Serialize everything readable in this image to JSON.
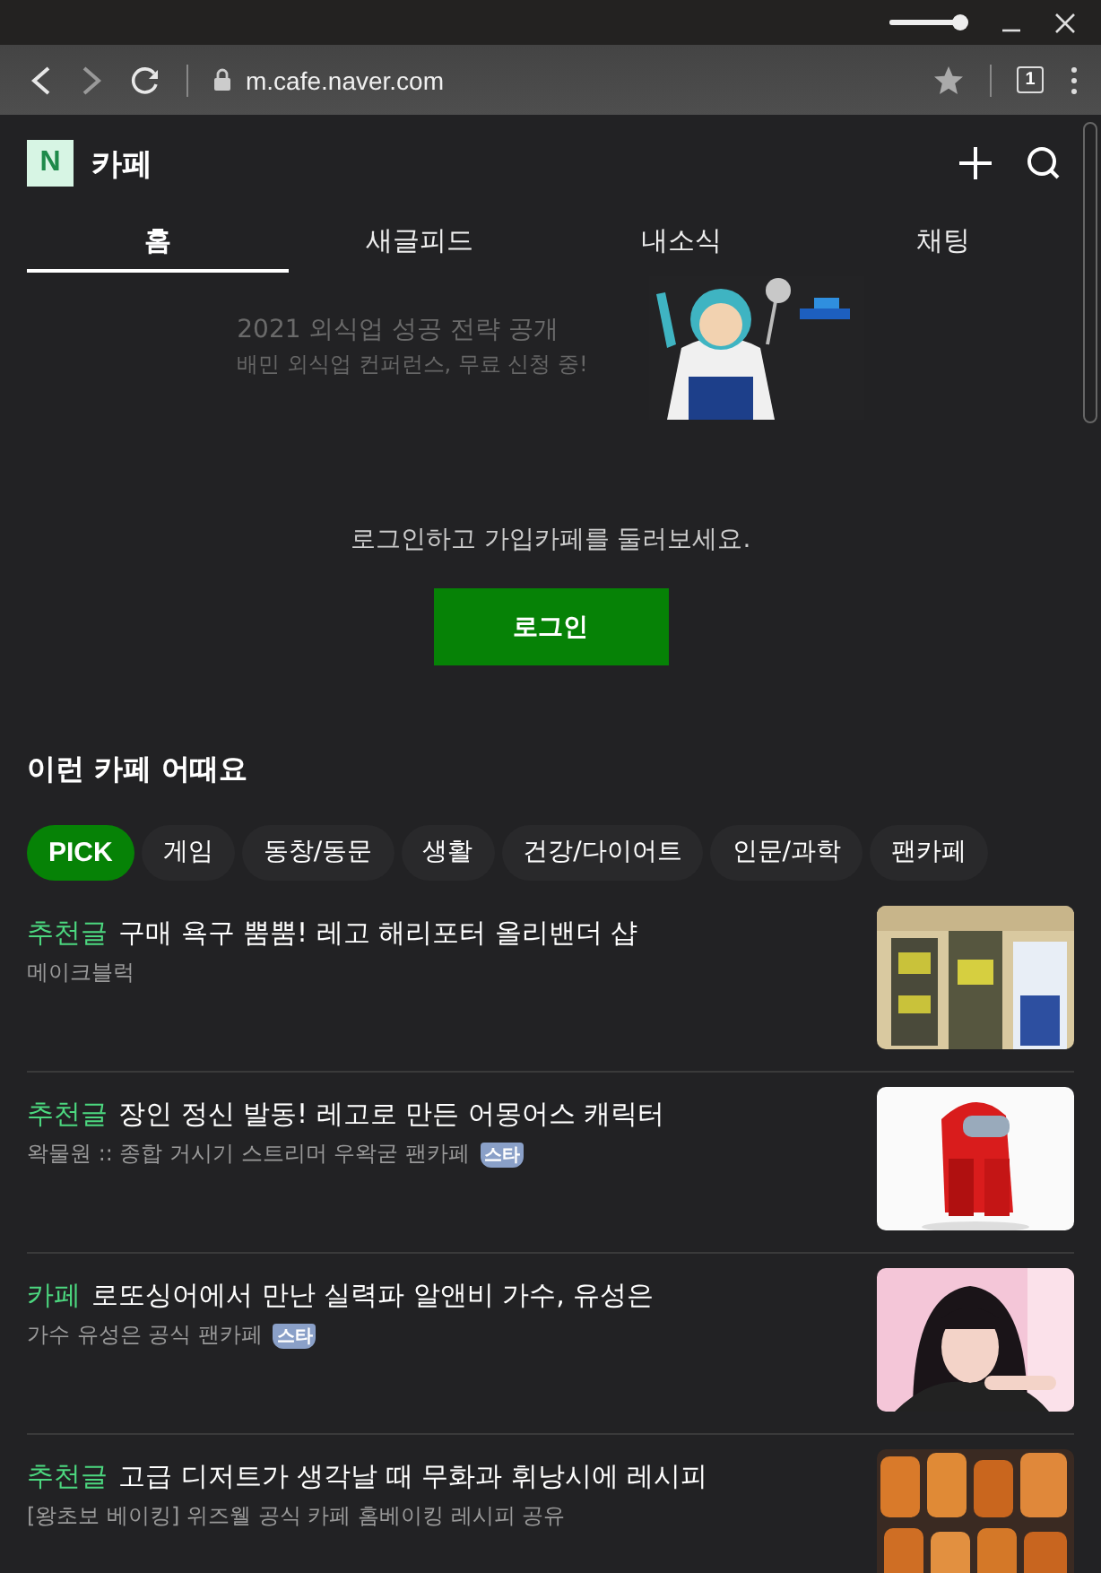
{
  "window": {
    "zoom_slider": {
      "level": 0.85
    }
  },
  "browser": {
    "url": "m.cafe.naver.com",
    "tab_count": "1"
  },
  "header": {
    "logo": "N",
    "title": "카페"
  },
  "tabs": [
    {
      "label": "홈",
      "selected": true
    },
    {
      "label": "새글피드",
      "selected": false
    },
    {
      "label": "내소식",
      "selected": false
    },
    {
      "label": "채팅",
      "selected": false
    }
  ],
  "banner": {
    "headline": "2021 외식업 성공 전략 공개",
    "subline": "배민 외식업 컨퍼런스, 무료 신청 중!"
  },
  "login": {
    "prompt": "로그인하고 가입카페를 둘러보세요.",
    "button": "로그인"
  },
  "section_title": "이런 카페 어때요",
  "chips": [
    {
      "label": "PICK",
      "selected": true
    },
    {
      "label": "게임",
      "selected": false
    },
    {
      "label": "동창/동문",
      "selected": false
    },
    {
      "label": "생활",
      "selected": false
    },
    {
      "label": "건강/다이어트",
      "selected": false
    },
    {
      "label": "인문/과학",
      "selected": false
    },
    {
      "label": "팬카페",
      "selected": false
    }
  ],
  "articles": [
    {
      "tag": "추천글",
      "title": "구매 욕구 뿜뿜! 레고 해리포터 올리밴더 샵",
      "cafe": "메이크블럭",
      "kind": "picture"
    },
    {
      "tag": "추천글",
      "title": "장인 정신 발동! 레고로 만든 어몽어스 캐릭터",
      "cafe": "왁물원 :: 종합 거시기 스트리머 우왁굳 팬카페",
      "badge": "스타",
      "kind": "picture"
    },
    {
      "tag": "카페",
      "title": "로또싱어에서 만난 실력파 알앤비 가수, 유성은",
      "cafe": "가수 유성은 공식 팬카페",
      "badge": "스타",
      "kind": "picture"
    },
    {
      "tag": "추천글",
      "title": "고급 디저트가 생각날 때 무화과 휘낭시에 레시피",
      "cafe": "[왕초보 베이킹] 위즈웰 공식 카페 홈베이킹 레시피 공유",
      "kind": "picture"
    }
  ]
}
